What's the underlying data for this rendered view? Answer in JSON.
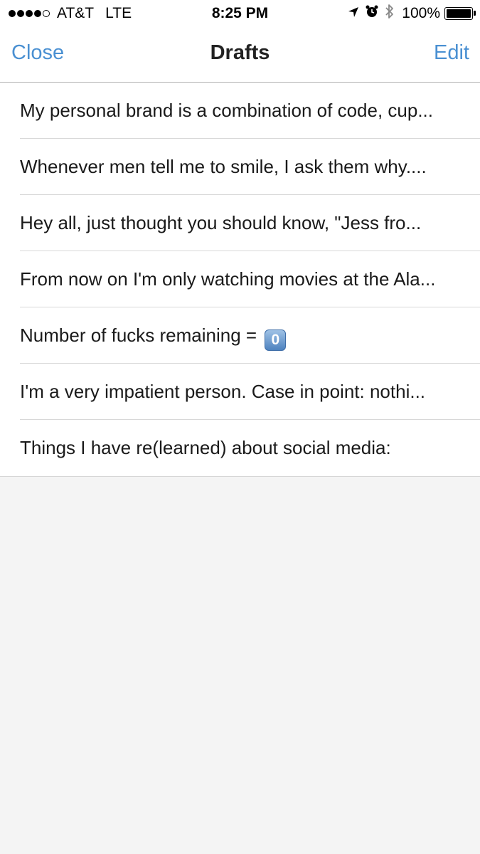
{
  "status_bar": {
    "carrier": "AT&T",
    "network": "LTE",
    "time": "8:25 PM",
    "battery_percent": "100%",
    "battery_level": 1.0,
    "icons": [
      "location-arrow-icon",
      "alarm-clock-icon",
      "bluetooth-icon"
    ]
  },
  "nav": {
    "close_label": "Close",
    "title": "Drafts",
    "edit_label": "Edit"
  },
  "drafts": [
    {
      "text": "My personal brand is a combination of code, cup..."
    },
    {
      "text": "Whenever men tell me to smile, I ask them why...."
    },
    {
      "text": "Hey all, just thought you should know, \"Jess fro..."
    },
    {
      "text": "From now on I'm only watching movies at the Ala..."
    },
    {
      "text": "Number of fucks remaining =",
      "emoji": "0"
    },
    {
      "text": "I'm a very impatient person. Case in point: nothi..."
    },
    {
      "text": "Things I have re(learned) about social media:"
    }
  ],
  "colors": {
    "accent": "#4a90d2",
    "background": "#f4f4f4"
  }
}
